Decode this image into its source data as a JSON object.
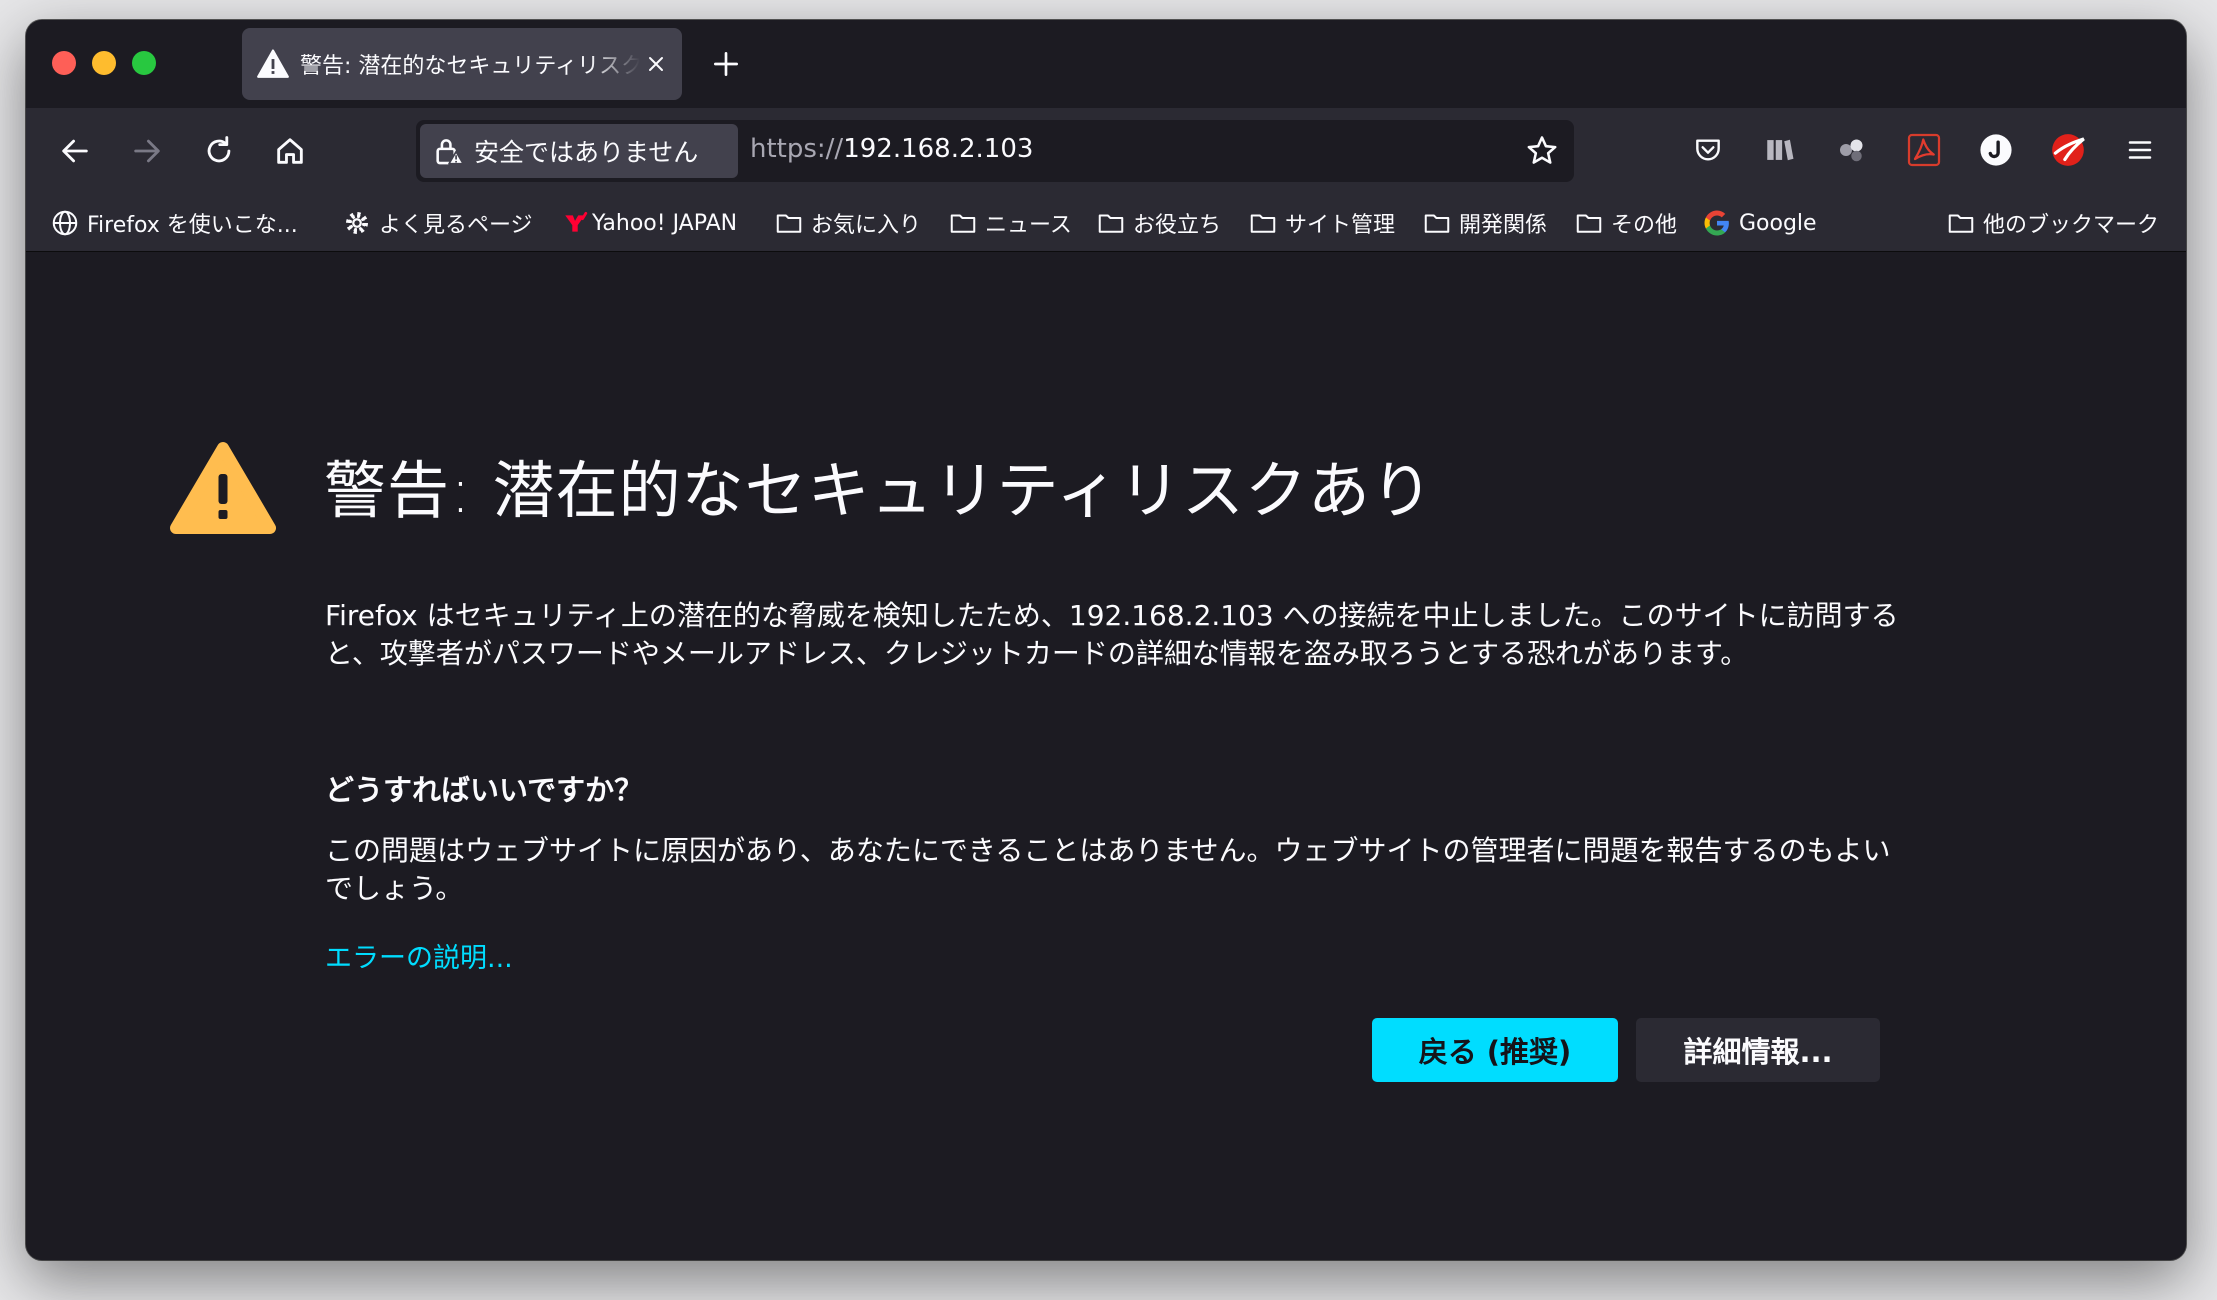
{
  "tab": {
    "title": "警告: 潜在的なセキュリティリスク",
    "close_icon": "close-icon",
    "new_tab_icon": "plus-icon"
  },
  "nav": {
    "identity_label": "安全ではありません",
    "url_scheme": "https://",
    "url_host": "192.168.2.103"
  },
  "bookmarks": [
    {
      "label": "Firefox を使いこな...",
      "icon": "globe-icon"
    },
    {
      "label": "よく見るページ",
      "icon": "gear-icon"
    },
    {
      "label": "Yahoo! JAPAN",
      "icon": "yahoo-icon"
    },
    {
      "label": "お気に入り",
      "icon": "folder-icon"
    },
    {
      "label": "ニュース",
      "icon": "folder-icon"
    },
    {
      "label": "お役立ち",
      "icon": "folder-icon"
    },
    {
      "label": "サイト管理",
      "icon": "folder-icon"
    },
    {
      "label": "開発関係",
      "icon": "folder-icon"
    },
    {
      "label": "その他",
      "icon": "folder-icon"
    },
    {
      "label": "Google",
      "icon": "google-icon"
    }
  ],
  "other_bookmarks": "他のブックマーク",
  "error": {
    "title": "警告: 潜在的なセキュリティリスクあり",
    "description": "Firefox はセキュリティ上の潜在的な脅威を検知したため、192.168.2.103 への接続を中止しました。このサイトに訪問すると、攻撃者がパスワードやメールアドレス、クレジットカードの詳細な情報を盗み取ろうとする恐れがあります。",
    "what_heading": "どうすればいいですか？",
    "what_text": "この問題はウェブサイトに原因があり、あなたにできることはありません。ウェブサイトの管理者に問題を報告するのもよいでしょう。",
    "learn_more": "エラーの説明...",
    "back_button": "戻る (推奨)",
    "advanced_button": "詳細情報..."
  },
  "colors": {
    "accent": "#00ddff",
    "warning": "#ffbd4f",
    "background": "#1c1b22",
    "toolbar": "#2b2a33"
  }
}
